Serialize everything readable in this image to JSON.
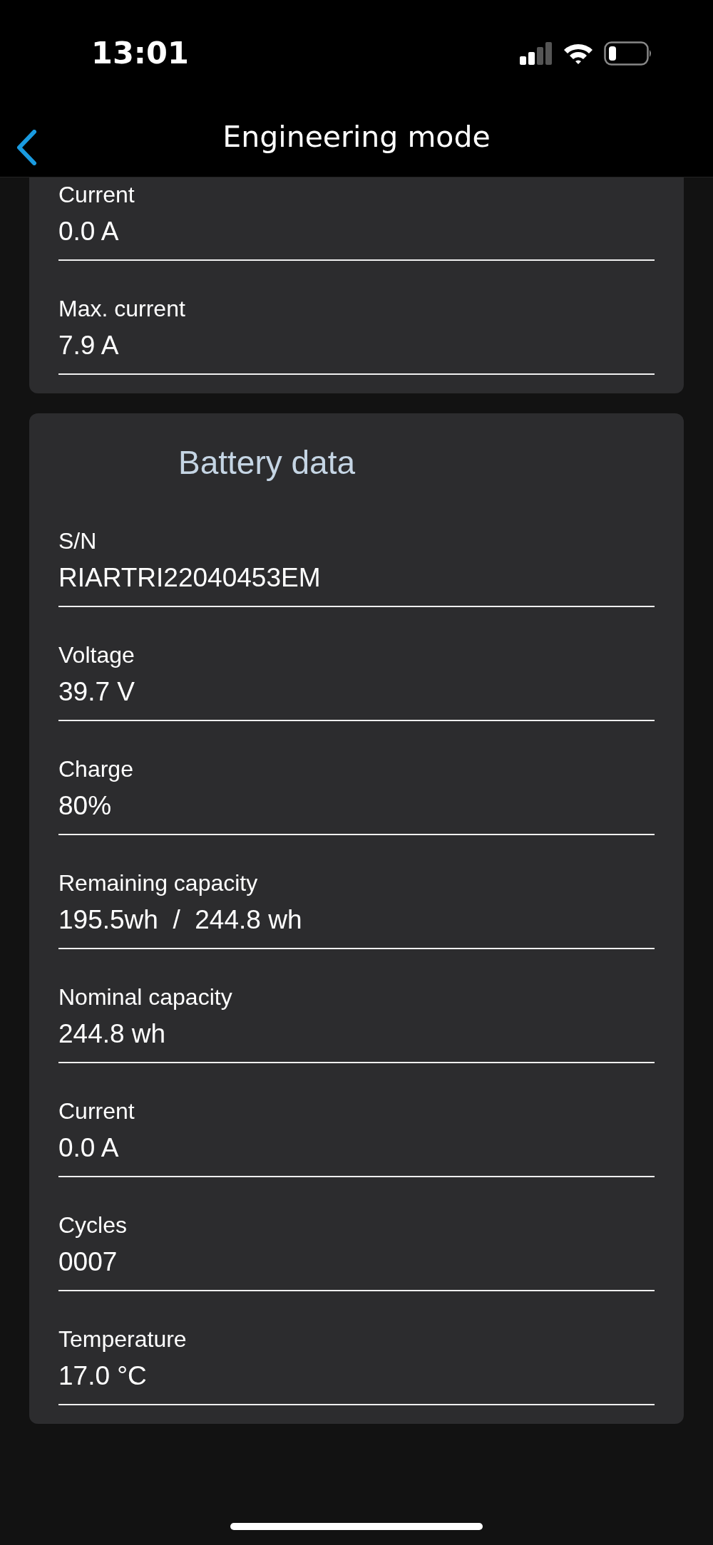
{
  "status_bar": {
    "time": "13:01"
  },
  "header": {
    "title": "Engineering mode"
  },
  "sections": [
    {
      "rows": [
        {
          "label": "Current",
          "value": "0.0 A"
        },
        {
          "label": "Max. current",
          "value": "7.9 A"
        }
      ]
    },
    {
      "title": "Battery data",
      "rows": [
        {
          "label": "S/N",
          "value": "RIARTRI22040453EM"
        },
        {
          "label": "Voltage",
          "value": "39.7 V"
        },
        {
          "label": "Charge",
          "value": "80%"
        },
        {
          "label": "Remaining capacity",
          "value": "195.5wh  /  244.8 wh"
        },
        {
          "label": "Nominal capacity",
          "value": "244.8 wh"
        },
        {
          "label": "Current",
          "value": "0.0 A"
        },
        {
          "label": "Cycles",
          "value": "0007"
        },
        {
          "label": "Temperature",
          "value": "17.0 °C"
        }
      ]
    }
  ]
}
